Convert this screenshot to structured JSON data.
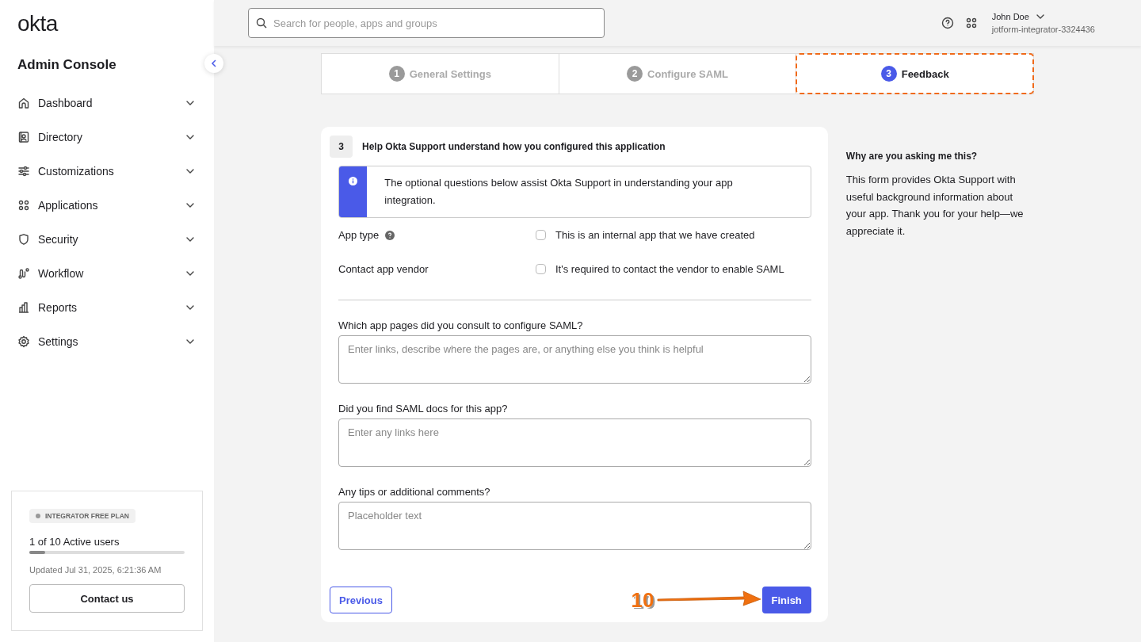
{
  "sidebar": {
    "logo": "okta",
    "title": "Admin Console",
    "items": [
      {
        "label": "Dashboard",
        "expanded": false
      },
      {
        "label": "Directory",
        "expanded": false
      },
      {
        "label": "Customizations",
        "expanded": false
      },
      {
        "label": "Applications",
        "expanded": false
      },
      {
        "label": "Security",
        "expanded": false
      },
      {
        "label": "Workflow",
        "expanded": false
      },
      {
        "label": "Reports",
        "expanded": false
      },
      {
        "label": "Settings",
        "expanded": false
      }
    ],
    "plan": {
      "badge": "INTEGRATOR FREE PLAN",
      "usage": "1 of 10 Active users",
      "level": 0.1,
      "updated": "Updated Jul 31, 2025, 6:21:36 AM",
      "button": "Contact us"
    }
  },
  "top_bar": {
    "search": {
      "placeholder": "Search for people, apps and groups"
    },
    "user": {
      "name": "John Doe",
      "org": "jotform-integrator-3324436"
    }
  },
  "steps": [
    {
      "number": "1",
      "label": "General Settings",
      "selected": false,
      "highlighted": false
    },
    {
      "number": "2",
      "label": "Configure SAML",
      "selected": false,
      "highlighted": false
    },
    {
      "number": "3",
      "label": "Feedback",
      "selected": true,
      "highlighted": true
    }
  ],
  "form": {
    "section_number": "3",
    "title": "Help Okta Support understand how you configured this application",
    "info": "The optional questions below assist Okta Support in understanding your app integration.",
    "options": [
      {
        "label": "App type",
        "has_help": true,
        "text": "This is an internal app that we have created",
        "checked": false
      },
      {
        "label": "Contact app vendor",
        "has_help": false,
        "text": "It's required to contact the vendor to enable SAML",
        "checked": false
      }
    ],
    "questions": [
      {
        "label": "Which app pages did you consult to configure SAML?",
        "placeholder": "Enter links, describe where the pages are, or anything else you think is helpful"
      },
      {
        "label": "Did you find SAML docs for this app?",
        "placeholder": "Enter any links here"
      },
      {
        "label": "Any tips or additional comments?",
        "placeholder": "Placeholder text"
      }
    ],
    "buttons": {
      "previous": "Previous",
      "finish": "Finish"
    },
    "callout": "10"
  },
  "aside": {
    "title": "Why are you asking me this?",
    "text": "This form provides Okta Support with useful background information about your app. Thank you for your help—we appreciate it."
  }
}
